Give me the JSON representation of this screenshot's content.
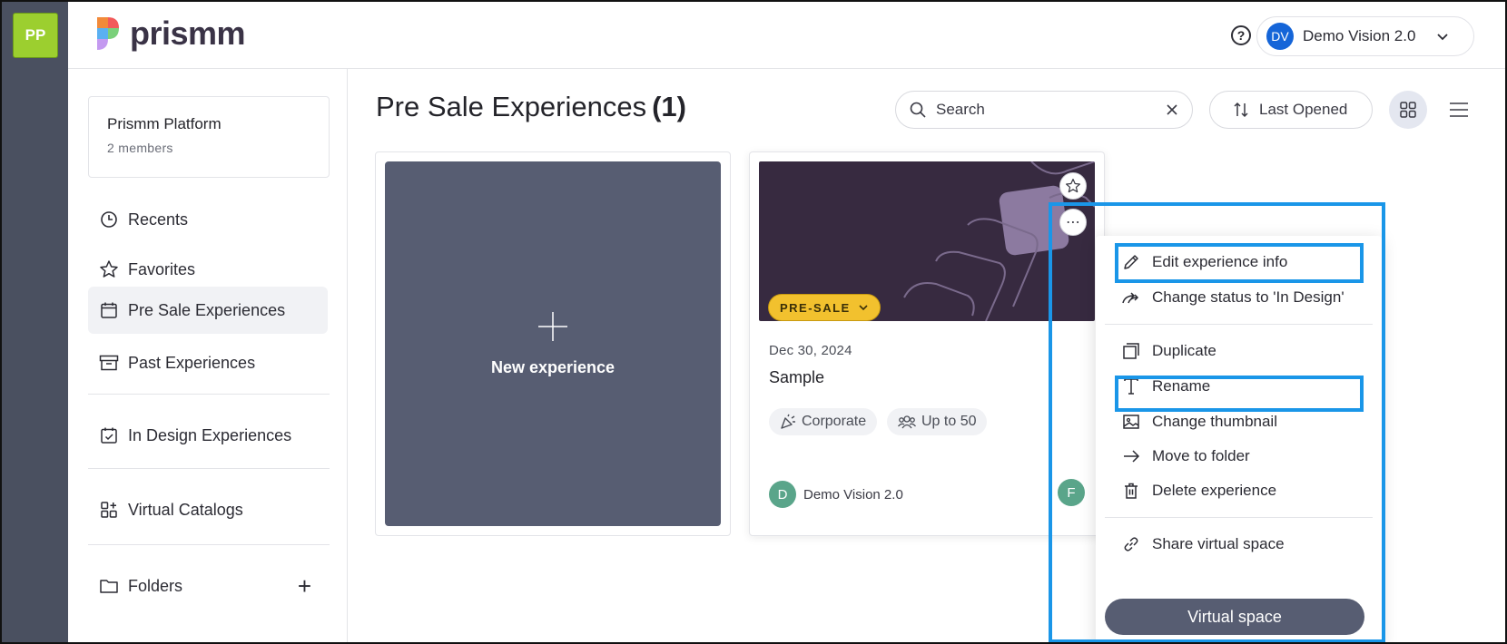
{
  "workspace": {
    "initials": "PP"
  },
  "header": {
    "logo_text": "prismm",
    "help_icon": "help-circle-icon",
    "user": {
      "initials": "DV",
      "name": "Demo Vision 2.0"
    }
  },
  "sidebar": {
    "org": {
      "name": "Prismm Platform",
      "members": "2 members"
    },
    "items": [
      {
        "label": "Recents",
        "icon": "clock-icon"
      },
      {
        "label": "Favorites",
        "icon": "star-icon"
      },
      {
        "label": "Pre Sale Experiences",
        "icon": "calendar-icon",
        "active": true
      },
      {
        "label": "Past Experiences",
        "icon": "archive-icon"
      },
      {
        "label": "In Design Experiences",
        "icon": "calendar-check-icon"
      },
      {
        "label": "Virtual Catalogs",
        "icon": "grid-plus-icon"
      },
      {
        "label": "Folders",
        "icon": "folder-icon"
      }
    ]
  },
  "main": {
    "title": "Pre Sale Experiences",
    "count": "(1)",
    "search": {
      "placeholder": "Search"
    },
    "sort_label": "Last Opened",
    "new_card_label": "New experience"
  },
  "experience": {
    "badge": "PRE-SALE",
    "date": "Dec 30, 2024",
    "name": "Sample",
    "tags": [
      "Corporate",
      "Up to 50"
    ],
    "owner": {
      "initial": "D",
      "name": "Demo Vision 2.0"
    },
    "collaborator_initial": "F"
  },
  "context_menu": {
    "items": [
      "Edit experience info",
      "Change status to 'In Design'",
      "Duplicate",
      "Rename",
      "Change thumbnail",
      "Move to folder",
      "Delete experience",
      "Share virtual space"
    ],
    "primary_button": "Virtual space"
  },
  "colors": {
    "rail": "#4a5060",
    "accent_green": "#9ccf2f",
    "card_dark": "#575d72",
    "badge_yellow": "#f2c12e",
    "highlight_blue": "#1a96e8"
  }
}
